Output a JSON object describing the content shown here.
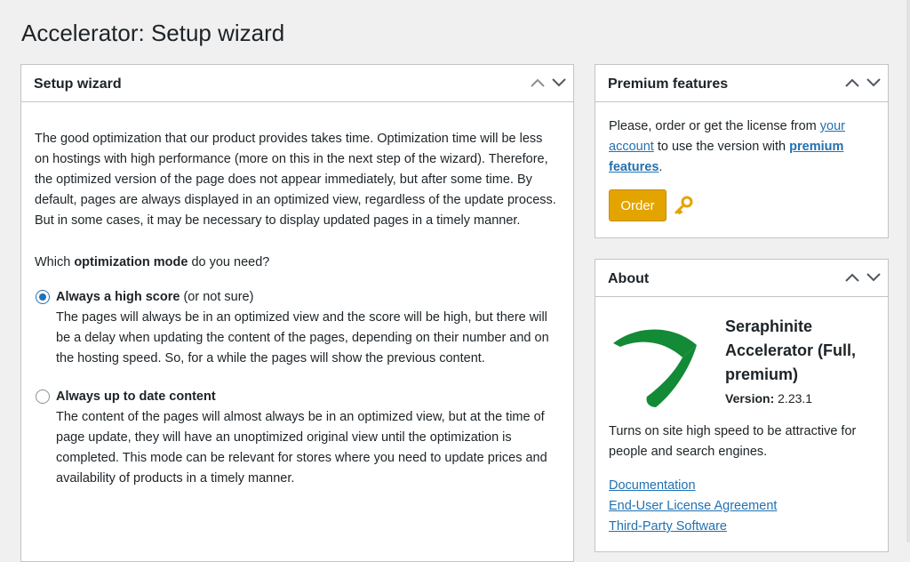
{
  "page_title": "Accelerator: Setup wizard",
  "wizard": {
    "title": "Setup wizard",
    "intro": "The good optimization that our product provides takes time. Optimization time will be less on hostings with high performance (more on this in the next step of the wizard). Therefore, the optimized version of the page does not appear immediately, but after some time. By default, pages are always displayed in an optimized view, regardless of the update process. But in some cases, it may be necessary to display updated pages in a timely manner.",
    "question_prefix": "Which ",
    "question_bold": "optimization mode",
    "question_suffix": " do you need?",
    "options": [
      {
        "title": "Always a high score",
        "note": " (or not sure)",
        "desc": "The pages will always be in an optimized view and the score will be high, but there will be a delay when updating the content of the pages, depending on their number and on the hosting speed. So, for a while the pages will show the previous content.",
        "selected": true
      },
      {
        "title": "Always up to date content",
        "note": "",
        "desc": "The content of the pages will almost always be in an optimized view, but at the time of page update, they will have an unoptimized original view until the optimization is completed. This mode can be relevant for stores where you need to update prices and availability of products in a timely manner.",
        "selected": false
      }
    ]
  },
  "premium": {
    "title": "Premium features",
    "text1": "Please, order or get the license from ",
    "link_account": "your account",
    "text2": " to use the version with ",
    "link_premium": "premium features",
    "text3": ".",
    "order_label": "Order"
  },
  "about": {
    "title": "About",
    "product_name": "Seraphinite Accelerator (Full, premium)",
    "version_label": "Version:",
    "version_value": "2.23.1",
    "description": "Turns on site high speed to be attractive for people and search engines.",
    "links": [
      "Documentation",
      "End-User License Agreement",
      "Third-Party Software"
    ]
  },
  "colors": {
    "accent": "#2271b1",
    "order_button": "#e4a400",
    "logo_green": "#138a36"
  },
  "icons": [
    "chevron-up-icon",
    "chevron-down-icon",
    "key-icon",
    "seraphinite-logo"
  ]
}
